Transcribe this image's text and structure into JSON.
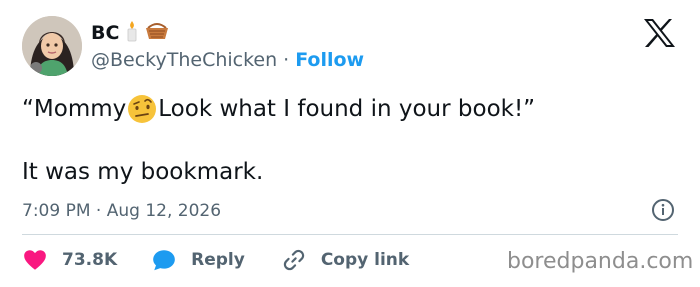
{
  "author": {
    "name": "BC",
    "handle": "@BeckyTheChicken",
    "separator": "·",
    "follow_label": "Follow",
    "name_emojis": [
      "candle-icon",
      "basket-icon"
    ]
  },
  "tweet": {
    "text_before_emoji": "“Mommy",
    "inline_emoji": "raised-eyebrow-emoji",
    "text_after_emoji": "Look what I found in your book!”",
    "line2": "It was my bookmark."
  },
  "timestamp": {
    "time": "7:09 PM",
    "separator": "·",
    "date": "Aug 12, 2026"
  },
  "actions": {
    "likes": "73.8K",
    "reply": "Reply",
    "copy_link": "Copy link"
  },
  "watermark": "boredpanda.com",
  "colors": {
    "text": "#0f1419",
    "muted": "#536471",
    "accent": "#1d9bf0",
    "like": "#f91880",
    "divider": "#cfd9de"
  }
}
